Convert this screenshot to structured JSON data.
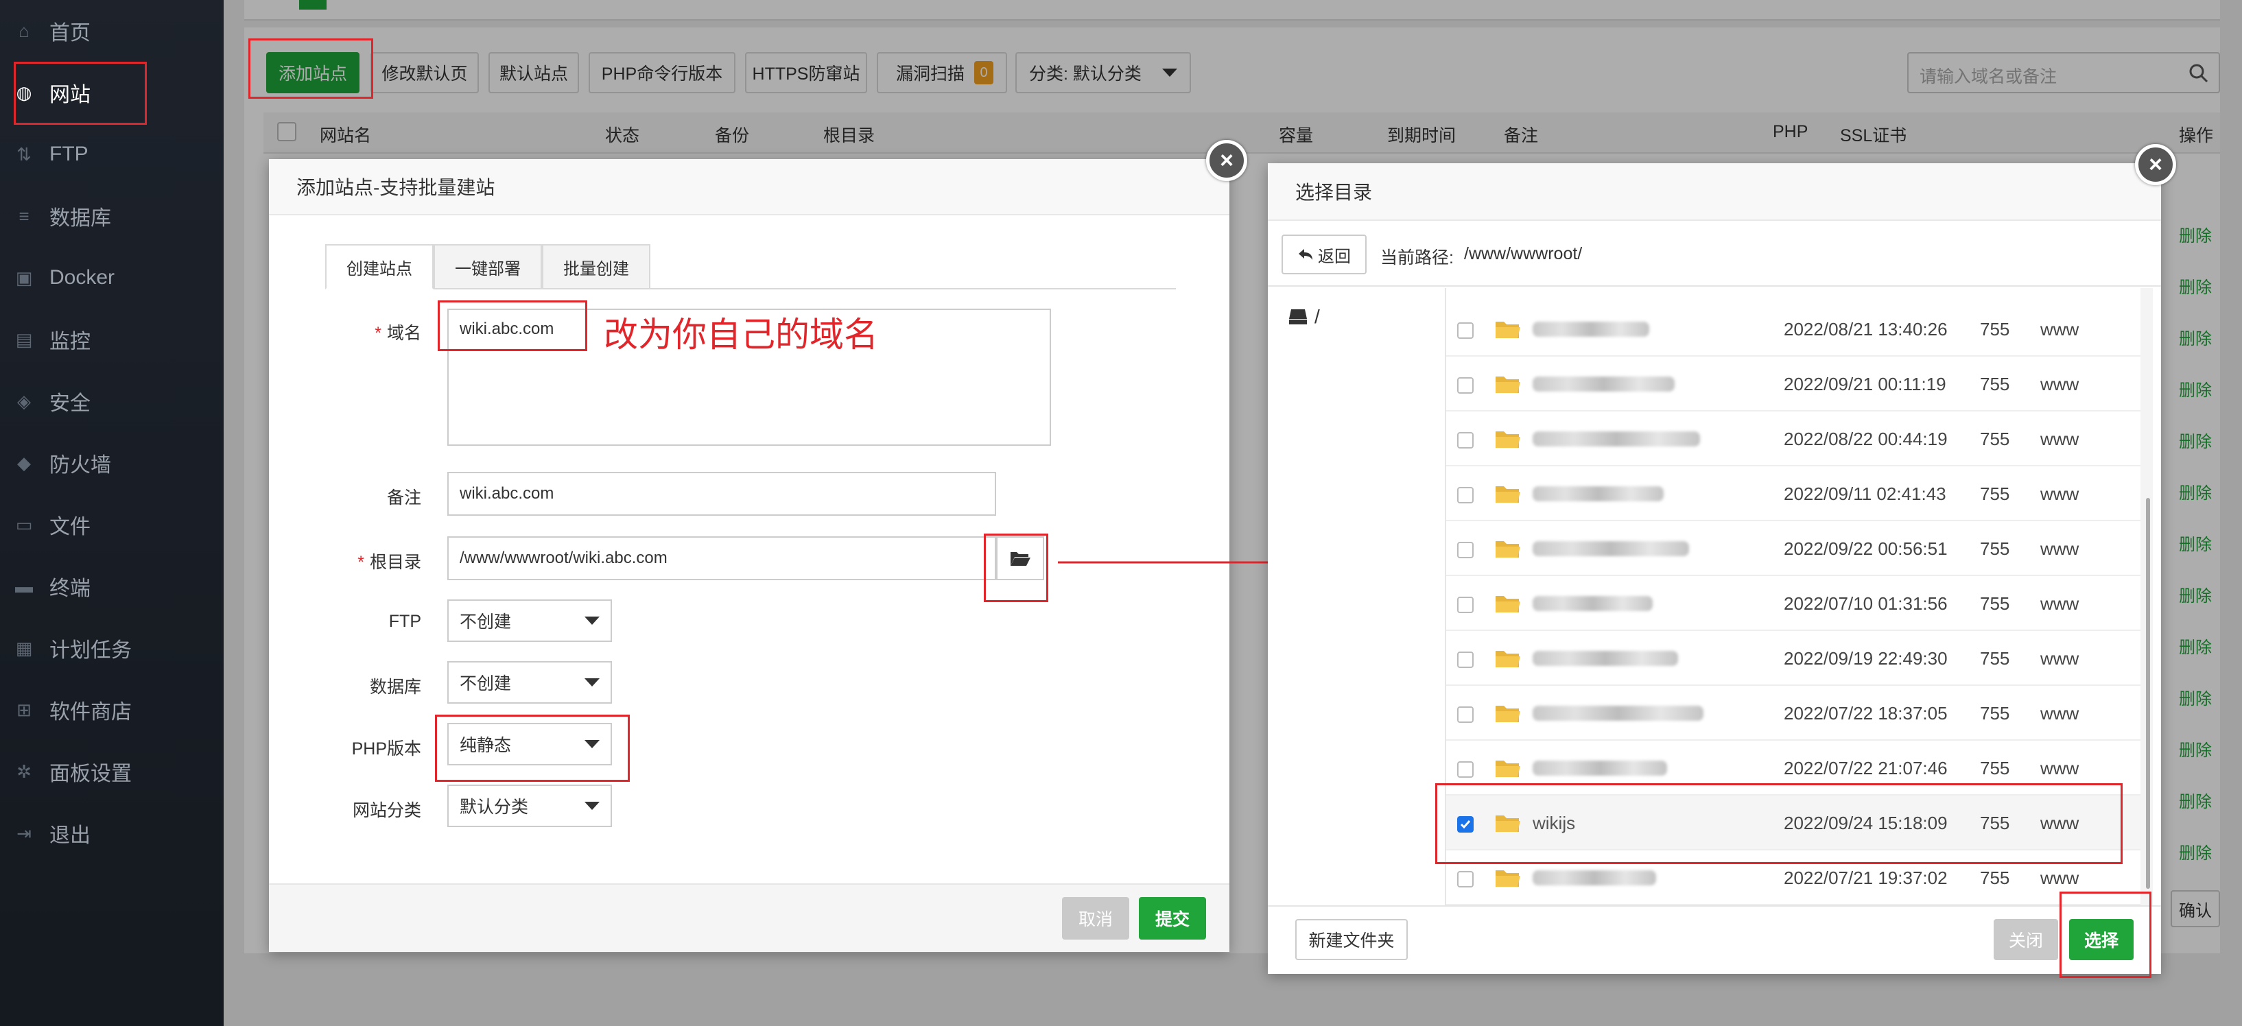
{
  "sidebar": {
    "items": [
      {
        "label": "首页",
        "icon": "home-icon"
      },
      {
        "label": "网站",
        "icon": "globe-icon"
      },
      {
        "label": "FTP",
        "icon": "ftp-icon"
      },
      {
        "label": "数据库",
        "icon": "database-icon"
      },
      {
        "label": "Docker",
        "icon": "docker-icon"
      },
      {
        "label": "监控",
        "icon": "monitor-icon"
      },
      {
        "label": "安全",
        "icon": "shield-icon"
      },
      {
        "label": "防火墙",
        "icon": "firewall-icon"
      },
      {
        "label": "文件",
        "icon": "folder-icon"
      },
      {
        "label": "终端",
        "icon": "terminal-icon"
      },
      {
        "label": "计划任务",
        "icon": "calendar-icon"
      },
      {
        "label": "软件商店",
        "icon": "grid-icon"
      },
      {
        "label": "面板设置",
        "icon": "gear-icon"
      },
      {
        "label": "退出",
        "icon": "logout-icon"
      }
    ]
  },
  "toolbar": {
    "add_site": "添加站点",
    "edit_default_page": "修改默认页",
    "default_site": "默认站点",
    "php_cli": "PHP命令行版本",
    "https_guard": "HTTPS防窜站",
    "vuln_scan": "漏洞扫描",
    "vuln_count": "0",
    "category": "分类: 默认分类",
    "search_placeholder": "请输入域名或备注"
  },
  "table": {
    "headers": {
      "site_name": "网站名",
      "status": "状态",
      "backup": "备份",
      "root": "根目录",
      "capacity": "容量",
      "expire": "到期时间",
      "note": "备注",
      "php": "PHP",
      "ssl": "SSL证书",
      "ops": "操作"
    },
    "delete_label": "删除",
    "confirm": "确认"
  },
  "add_site_dialog": {
    "title": "添加站点-支持批量建站",
    "tabs": [
      "创建站点",
      "一键部署",
      "批量创建"
    ],
    "domain_label": "域名",
    "domain_value": "wiki.abc.com",
    "annotation": "改为你自己的域名",
    "note_label": "备注",
    "note_value": "wiki.abc.com",
    "root_label": "根目录",
    "root_value": "/www/wwwroot/wiki.abc.com",
    "ftp_label": "FTP",
    "ftp_value": "不创建",
    "db_label": "数据库",
    "db_value": "不创建",
    "php_label": "PHP版本",
    "php_value": "纯静态",
    "category_label": "网站分类",
    "category_value": "默认分类",
    "cancel": "取消",
    "submit": "提交"
  },
  "dir_dialog": {
    "title": "选择目录",
    "back": "返回",
    "path_label": "当前路径:",
    "path_value": "/www/wwwroot/",
    "tree_root": "/",
    "rows": [
      {
        "name": "",
        "date": "2022/08/21 13:40:26",
        "perm": "755",
        "owner": "www",
        "checked": false
      },
      {
        "name": "",
        "date": "2022/09/21 00:11:19",
        "perm": "755",
        "owner": "www",
        "checked": false
      },
      {
        "name": "",
        "date": "2022/08/22 00:44:19",
        "perm": "755",
        "owner": "www",
        "checked": false
      },
      {
        "name": "",
        "date": "2022/09/11 02:41:43",
        "perm": "755",
        "owner": "www",
        "checked": false
      },
      {
        "name": "",
        "date": "2022/09/22 00:56:51",
        "perm": "755",
        "owner": "www",
        "checked": false
      },
      {
        "name": "",
        "date": "2022/07/10 01:31:56",
        "perm": "755",
        "owner": "www",
        "checked": false
      },
      {
        "name": "",
        "date": "2022/09/19 22:49:30",
        "perm": "755",
        "owner": "www",
        "checked": false
      },
      {
        "name": "",
        "date": "2022/07/22 18:37:05",
        "perm": "755",
        "owner": "www",
        "checked": false
      },
      {
        "name": "",
        "date": "2022/07/22 21:07:46",
        "perm": "755",
        "owner": "www",
        "checked": false
      },
      {
        "name": "wikijs",
        "date": "2022/09/24 15:18:09",
        "perm": "755",
        "owner": "www",
        "checked": true
      },
      {
        "name": "",
        "date": "2022/07/21 19:37:02",
        "perm": "755",
        "owner": "www",
        "checked": false
      }
    ],
    "new_folder": "新建文件夹",
    "close": "关闭",
    "select": "选择"
  },
  "colors": {
    "accent_green": "#20a53a",
    "annotation_red": "#e0262b",
    "sidebar_bg": "#242c38"
  }
}
